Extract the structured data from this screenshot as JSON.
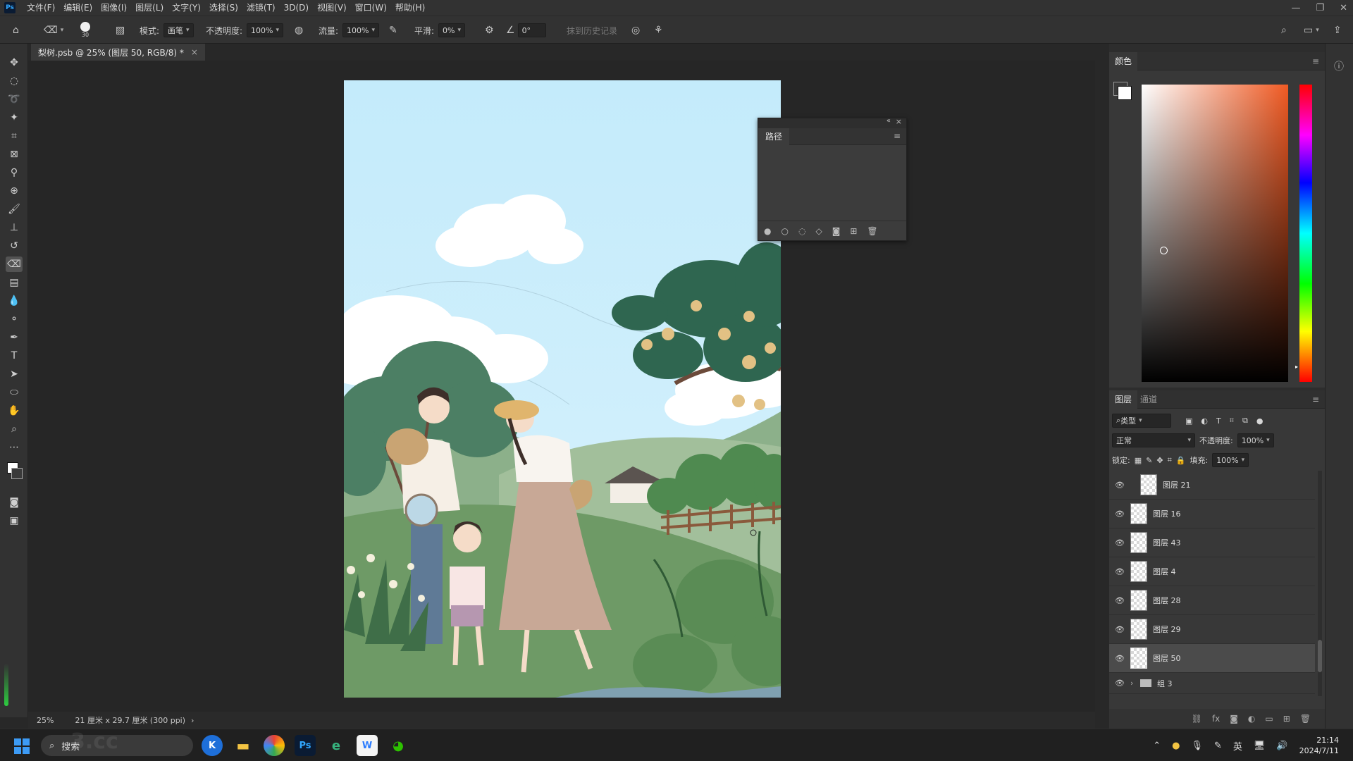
{
  "app": {
    "logo": "Ps"
  },
  "menu": [
    "文件(F)",
    "编辑(E)",
    "图像(I)",
    "图层(L)",
    "文字(Y)",
    "选择(S)",
    "滤镜(T)",
    "3D(D)",
    "视图(V)",
    "窗口(W)",
    "帮助(H)"
  ],
  "options": {
    "brush_size": "30",
    "mode_label": "模式:",
    "mode_value": "画笔",
    "opacity_label": "不透明度:",
    "opacity_value": "100%",
    "flow_label": "流量:",
    "flow_value": "100%",
    "smooth_label": "平滑:",
    "smooth_value": "0%",
    "angle_value": "0°",
    "history_label": "抹到历史记录"
  },
  "document": {
    "tab_title": "梨树.psb @ 25% (图层 50, RGB/8) *",
    "close": "×"
  },
  "status": {
    "zoom": "25%",
    "doc_size": "21 厘米 x 29.7 厘米 (300 ppi)",
    "arrow": "›"
  },
  "paths_panel": {
    "tab": "路径"
  },
  "color_panel": {
    "tab": "颜色",
    "fg": "#ffffff",
    "bg": "#3a3a3a",
    "hue": "#f05a23"
  },
  "layers_panel": {
    "tabs": [
      "图层",
      "通道"
    ],
    "filter_label": "类型",
    "blend_mode": "正常",
    "opacity_label": "不透明度:",
    "opacity_value": "100%",
    "lock_label": "锁定:",
    "fill_label": "填充:",
    "fill_value": "100%",
    "layers": [
      {
        "name": "图层 21",
        "selected": false
      },
      {
        "name": "图层 16",
        "selected": false
      },
      {
        "name": "图层 43",
        "selected": false
      },
      {
        "name": "图层 4",
        "selected": false
      },
      {
        "name": "图层 28",
        "selected": false
      },
      {
        "name": "图层 29",
        "selected": false
      },
      {
        "name": "图层 50",
        "selected": true
      }
    ],
    "group": {
      "name": "组 3"
    }
  },
  "taskbar": {
    "search_placeholder": "搜索",
    "lang": "英",
    "time": "21:14",
    "date": "2024/7/11",
    "apps": [
      "K",
      "Ps",
      "W"
    ]
  },
  "watermark": "3.cc"
}
